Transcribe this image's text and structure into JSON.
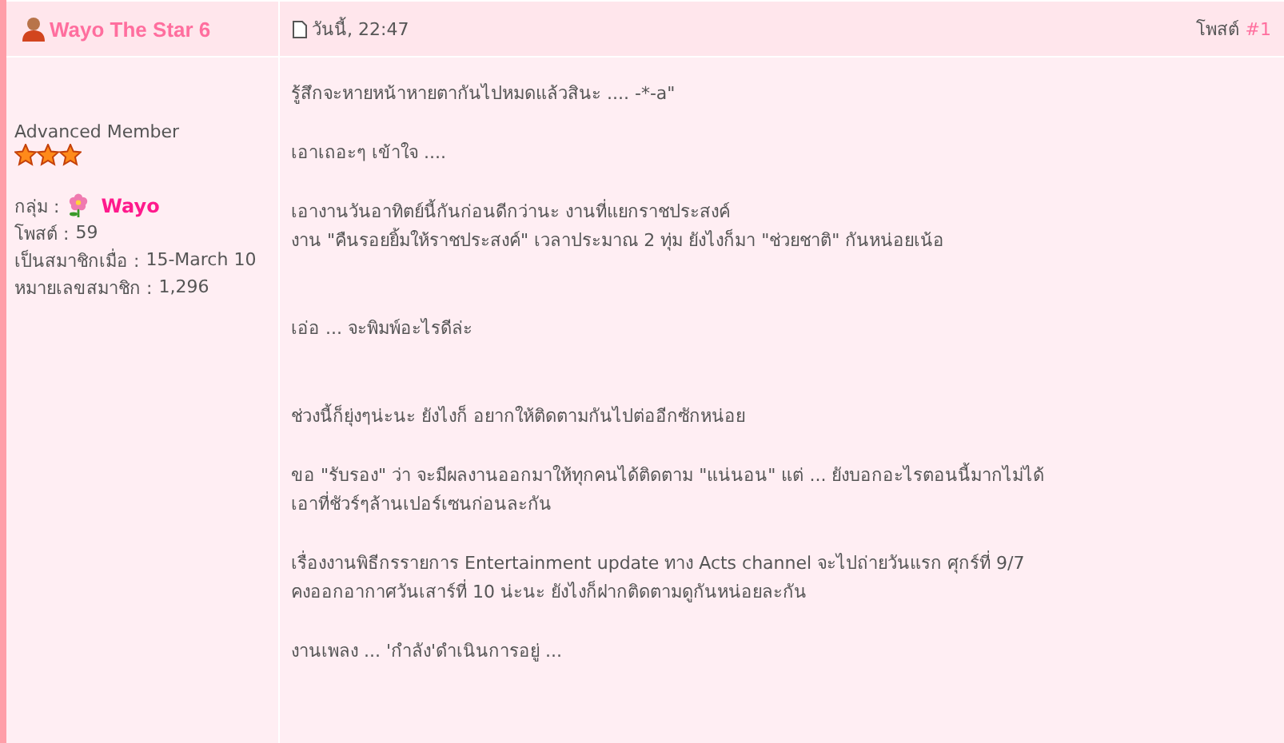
{
  "post": {
    "author": "Wayo The Star 6",
    "time": "วันนี้, 22:47",
    "post_label": "โพสต์",
    "post_number": "#1"
  },
  "profile": {
    "rank": "Advanced Member",
    "stars": 3,
    "fields": [
      {
        "kind": "group",
        "label": "กลุ่ม :",
        "value": "Wayo"
      },
      {
        "kind": "plain",
        "label": "โพสต์ :",
        "value": "59"
      },
      {
        "kind": "plain",
        "label": "เป็นสมาชิกเมื่อ :",
        "value": "15-March 10"
      },
      {
        "kind": "plain",
        "label": "หมายเลขสมาชิก :",
        "value": "1,296"
      }
    ]
  },
  "body": [
    {
      "kind": "short",
      "lines": [
        "รู้สึกจะหายหน้าหายตากันไปหมดแล้วสินะ .... -*-a\""
      ]
    },
    {
      "kind": "short",
      "lines": [
        "เอาเถอะๆ เข้าใจ ...."
      ]
    },
    {
      "kind": "long",
      "lines": [
        "เอางานวันอาทิตย์นี้กันก่อนดีกว่านะ งานที่แยกราชประสงค์",
        "งาน \"คืนรอยยิ้มให้ราชประสงค์\" เวลาประมาณ 2 ทุ่ม ยังไงก็มา \"ช่วยชาติ\" กันหน่อยเน้อ"
      ]
    },
    {
      "kind": "long",
      "lines": [
        "เอ่อ ... จะพิมพ์อะไรดีล่ะ"
      ]
    },
    {
      "kind": "short",
      "lines": [
        "ช่วงนี้ก็ยุ่งๆน่ะนะ ยังไงก็ อยากให้ติดตามกันไปต่ออีกซักหน่อย"
      ]
    },
    {
      "kind": "short",
      "lines": [
        "ขอ \"รับรอง\" ว่า จะมีผลงานออกมาให้ทุกคนได้ติดตาม \"แน่นอน\" แต่ ... ยังบอกอะไรตอนนี้มากไม่ได้",
        "เอาที่ชัวร์ๆล้านเปอร์เซนก่อนละกัน"
      ]
    },
    {
      "kind": "short",
      "lines": [
        "เรื่องงานพิธีกรรายการ Entertainment update ทาง Acts channel จะไปถ่ายวันแรก ศุกร์ที่ 9/7",
        "คงออกอากาศวันเสาร์ที่ 10 น่ะนะ ยังไงก็ฝากติดตามดูกันหน่อยละกัน"
      ]
    },
    {
      "kind": "long",
      "lines": [
        "งานเพลง ... 'กำลัง'ดำเนินการอยู่ ..."
      ]
    }
  ]
}
